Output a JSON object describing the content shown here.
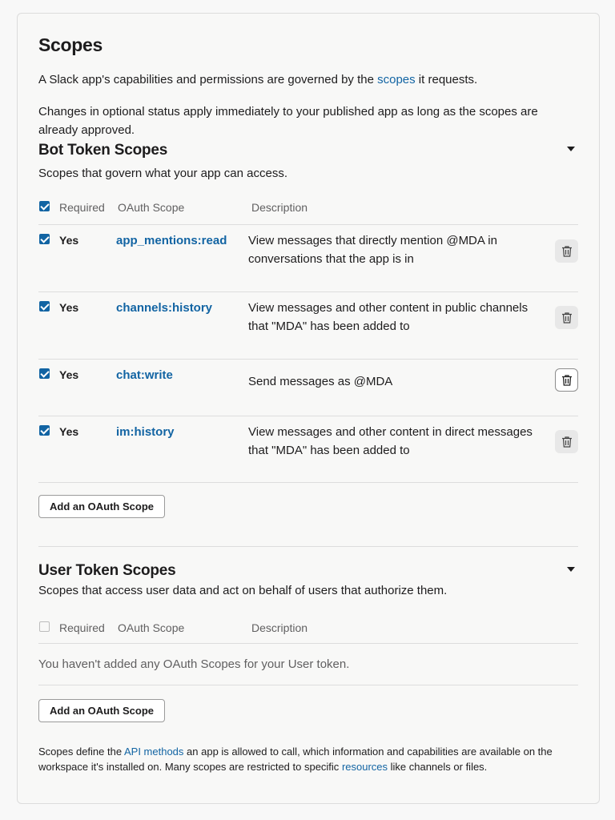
{
  "scopes": {
    "title": "Scopes",
    "intro_before": "A Slack app's capabilities and permissions are governed by the ",
    "intro_link": "scopes",
    "intro_after": " it requests.",
    "note": "Changes in optional status apply immediately to your published app as long as the scopes are already approved."
  },
  "bot": {
    "title": "Bot Token Scopes",
    "subtitle": "Scopes that govern what your app can access.",
    "headers": {
      "required": "Required",
      "scope": "OAuth Scope",
      "description": "Description"
    },
    "header_checked": true,
    "rows": [
      {
        "required": "Yes",
        "scope": "app_mentions:read",
        "description": "View messages that directly mention @MDA in conversations that the app is in"
      },
      {
        "required": "Yes",
        "scope": "channels:history",
        "description": "View messages and other content in public channels that \"MDA\" has been added to"
      },
      {
        "required": "Yes",
        "scope": "chat:write",
        "description": "Send messages as @MDA"
      },
      {
        "required": "Yes",
        "scope": "im:history",
        "description": "View messages and other content in direct messages that \"MDA\" has been added to"
      }
    ],
    "add_button": "Add an OAuth Scope"
  },
  "user": {
    "title": "User Token Scopes",
    "subtitle": "Scopes that access user data and act on behalf of users that authorize them.",
    "headers": {
      "required": "Required",
      "scope": "OAuth Scope",
      "description": "Description"
    },
    "header_checked": false,
    "empty": "You haven't added any OAuth Scopes for your User token.",
    "add_button": "Add an OAuth Scope"
  },
  "footer": {
    "part1": "Scopes define the ",
    "link1": "API methods",
    "part2": " an app is allowed to call, which information and capabilities are available on the workspace it's installed on. Many scopes are restricted to specific ",
    "link2": "resources",
    "part3": " like channels or files."
  },
  "colors": {
    "accent": "#1264a3",
    "text": "#1d1c1d",
    "muted": "#616061"
  }
}
